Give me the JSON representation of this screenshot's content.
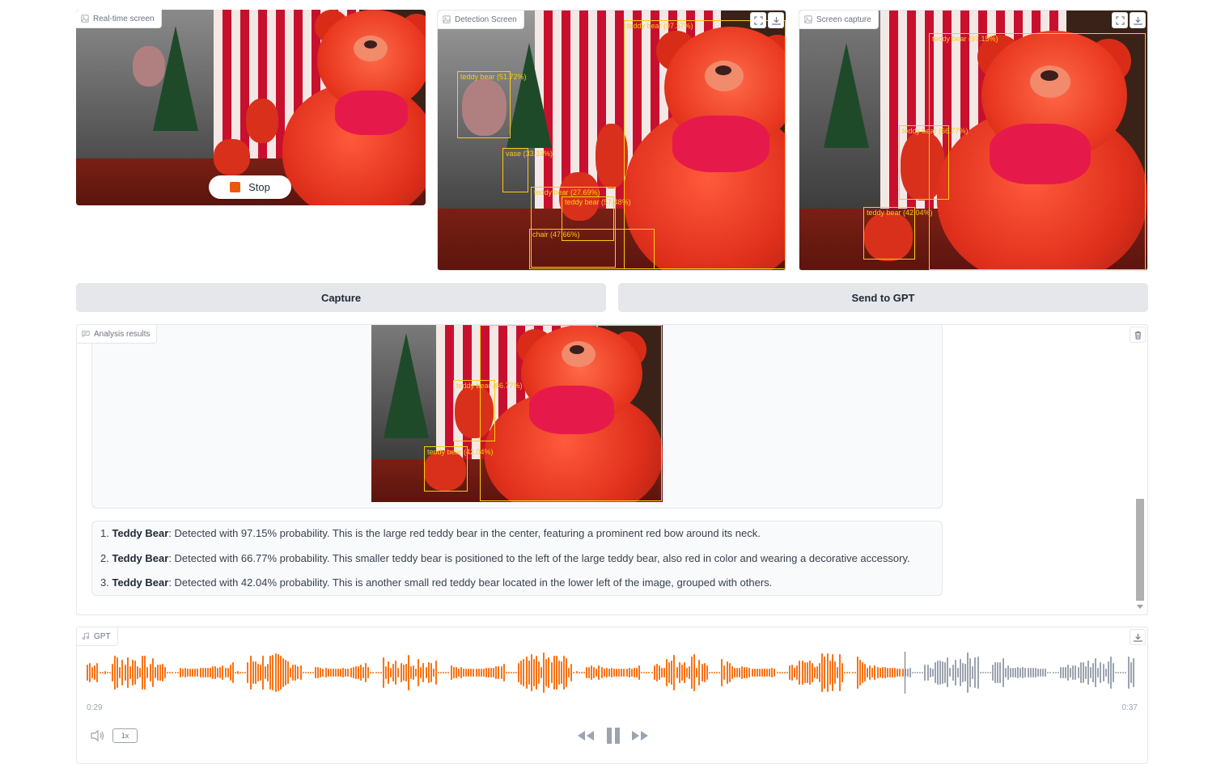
{
  "panels": {
    "realtime": {
      "label": "Real-time screen",
      "stop_label": "Stop"
    },
    "detection": {
      "label": "Detection Screen",
      "detections": [
        {
          "label": "teddy bear (97.37%)"
        },
        {
          "label": "teddy bear (51.72%)"
        },
        {
          "label": "vase (33.33%)"
        },
        {
          "label": "teddy bear (27.69%)"
        },
        {
          "label": "teddy bear (57.48%)"
        },
        {
          "label": "chair (47.66%)"
        }
      ]
    },
    "capture": {
      "label": "Screen capture",
      "detections": [
        {
          "label": "teddy bear (97.15%)"
        },
        {
          "label": "teddy bear (66.77%)"
        },
        {
          "label": "teddy bear (42.04%)"
        }
      ]
    }
  },
  "buttons": {
    "capture": "Capture",
    "send": "Send to GPT"
  },
  "analysis": {
    "label": "Analysis results",
    "image_detections": [
      {
        "label": "teddy bear (66.77%)"
      },
      {
        "label": "teddy bear (42.04%)"
      }
    ],
    "items": [
      {
        "num": "1.",
        "title": "Teddy Bear",
        "text": ": Detected with 97.15% probability. This is the large red teddy bear in the center, featuring a prominent red bow around its neck."
      },
      {
        "num": "2.",
        "title": "Teddy Bear",
        "text": ": Detected with 66.77% probability. This smaller teddy bear is positioned to the left of the large teddy bear, also red in color and wearing a decorative accessory."
      },
      {
        "num": "3.",
        "title": "Teddy Bear",
        "text": ": Detected with 42.04% probability. This is another small red teddy bear located in the lower left of the image, grouped with others."
      }
    ]
  },
  "audio": {
    "label": "GPT",
    "current_time": "0:29",
    "duration": "0:37",
    "speed": "1x",
    "progress": 0.78,
    "played_color": "#f97316",
    "unplayed_color": "#9ca3af"
  }
}
